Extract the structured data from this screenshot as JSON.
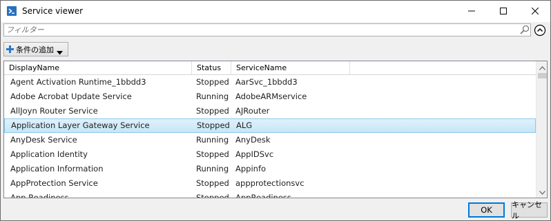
{
  "window": {
    "title": "Service viewer",
    "icon": "powershell-icon"
  },
  "filter": {
    "placeholder": "フィルター",
    "value": ""
  },
  "toolbar": {
    "add_condition_label": "条件の追加"
  },
  "table": {
    "columns": [
      "DisplayName",
      "Status",
      "ServiceName"
    ],
    "rows": [
      {
        "name": "Agent Activation Runtime_1bbdd3",
        "status": "Stopped",
        "service": "AarSvc_1bbdd3",
        "selected": false
      },
      {
        "name": "Adobe Acrobat Update Service",
        "status": "Running",
        "service": "AdobeARMservice",
        "selected": false
      },
      {
        "name": "AllJoyn Router Service",
        "status": "Stopped",
        "service": "AJRouter",
        "selected": false
      },
      {
        "name": "Application Layer Gateway Service",
        "status": "Stopped",
        "service": "ALG",
        "selected": true
      },
      {
        "name": "AnyDesk Service",
        "status": "Running",
        "service": "AnyDesk",
        "selected": false
      },
      {
        "name": "Application Identity",
        "status": "Stopped",
        "service": "AppIDSvc",
        "selected": false
      },
      {
        "name": "Application Information",
        "status": "Running",
        "service": "Appinfo",
        "selected": false
      },
      {
        "name": "AppProtection Service",
        "status": "Stopped",
        "service": "appprotectionsvc",
        "selected": false
      },
      {
        "name": "App Readiness",
        "status": "Stopped",
        "service": "AppReadiness",
        "selected": false
      }
    ]
  },
  "buttons": {
    "ok": "OK",
    "cancel": "キャンセル"
  },
  "colors": {
    "selection_bg": "#cce8f7",
    "selection_border": "#8ec8eb",
    "accent": "#0078d7"
  }
}
